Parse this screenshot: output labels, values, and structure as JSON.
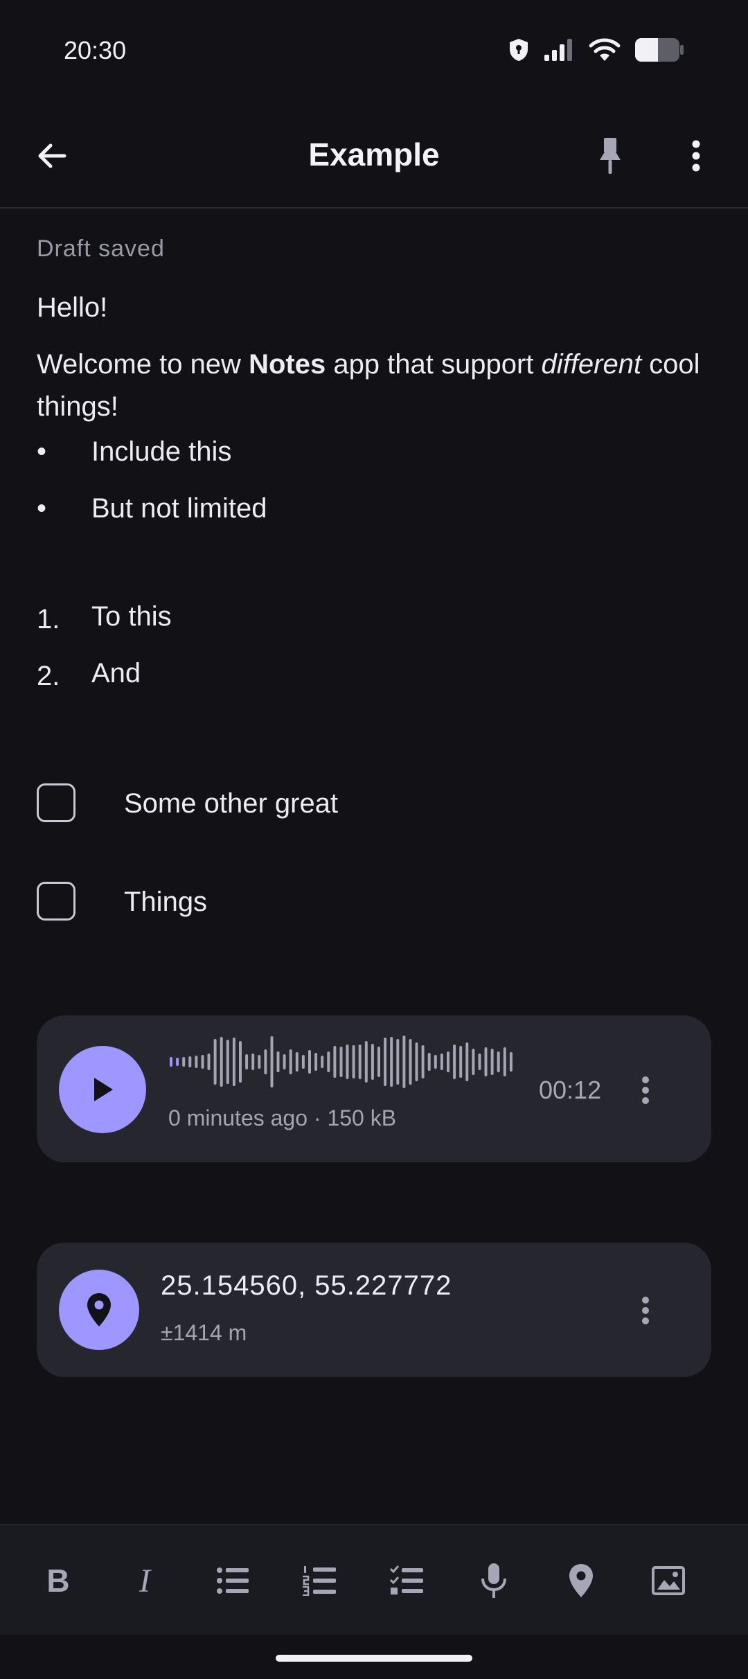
{
  "status_bar": {
    "time": "20:30",
    "icons": [
      "shield-lock-icon",
      "signal-icon",
      "wifi-icon",
      "battery-icon"
    ]
  },
  "toolbar_top": {
    "title": "Example",
    "back_icon": "arrow-left-icon",
    "pin_icon": "pin-icon",
    "more_icon": "more-vertical-icon"
  },
  "note": {
    "status": "Draft saved",
    "hello": "Hello!",
    "welcome": {
      "part1": "Welcome to new ",
      "bold": "Notes",
      "part2": " app that support ",
      "italic": "different",
      "part3": " cool things!"
    },
    "bullets": [
      {
        "marker": "•",
        "text": "Include this"
      },
      {
        "marker": "•",
        "text": "But not limited"
      }
    ],
    "numbered": [
      {
        "marker": "1.",
        "text": "To this"
      },
      {
        "marker": "2.",
        "text": "And"
      }
    ],
    "checklist": [
      {
        "text": "Some other great",
        "checked": false
      },
      {
        "text": "Things",
        "checked": false
      }
    ]
  },
  "audio": {
    "meta": "0 minutes ago · 150 kB",
    "duration": "00:12",
    "progress": 0.02
  },
  "location": {
    "coords": "25.154560, 55.227772",
    "accuracy": "±1414 m"
  },
  "format_toolbar": {
    "bold_label": "B",
    "italic_label": "I",
    "tools": [
      "bold",
      "italic",
      "bulleted-list",
      "numbered-list",
      "checklist",
      "microphone",
      "location",
      "image"
    ]
  },
  "colors": {
    "background": "#111116",
    "card": "#26262e",
    "accent": "#9d97ff",
    "muted_text": "#a4a4b2"
  }
}
